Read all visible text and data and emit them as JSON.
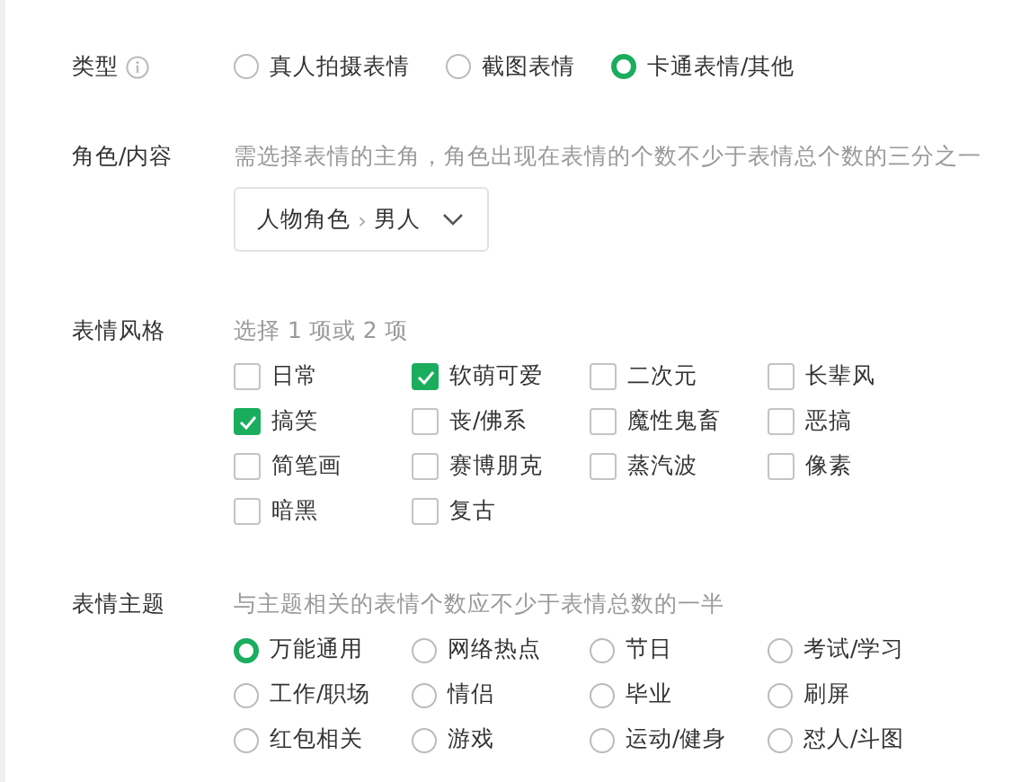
{
  "type_field": {
    "label": "类型",
    "options": [
      {
        "label": "真人拍摄表情",
        "selected": false
      },
      {
        "label": "截图表情",
        "selected": false
      },
      {
        "label": "卡通表情/其他",
        "selected": true
      }
    ]
  },
  "role": {
    "label": "角色/内容",
    "hint": "需选择表情的主角，角色出现在表情的个数不少于表情总个数的三分之一",
    "category": "人物角色",
    "separator": "›",
    "value": "男人"
  },
  "style": {
    "label": "表情风格",
    "hint": "选择 1 项或 2 项",
    "options": [
      {
        "label": "日常",
        "checked": false
      },
      {
        "label": "软萌可爱",
        "checked": true
      },
      {
        "label": "二次元",
        "checked": false
      },
      {
        "label": "长辈风",
        "checked": false
      },
      {
        "label": "搞笑",
        "checked": true
      },
      {
        "label": "丧/佛系",
        "checked": false
      },
      {
        "label": "魔性鬼畜",
        "checked": false
      },
      {
        "label": "恶搞",
        "checked": false
      },
      {
        "label": "简笔画",
        "checked": false
      },
      {
        "label": "赛博朋克",
        "checked": false
      },
      {
        "label": "蒸汽波",
        "checked": false
      },
      {
        "label": "像素",
        "checked": false
      },
      {
        "label": "暗黑",
        "checked": false
      },
      {
        "label": "复古",
        "checked": false
      }
    ]
  },
  "theme": {
    "label": "表情主题",
    "hint": "与主题相关的表情个数应不少于表情总数的一半",
    "options": [
      {
        "label": "万能通用",
        "selected": true
      },
      {
        "label": "网络热点",
        "selected": false
      },
      {
        "label": "节日",
        "selected": false
      },
      {
        "label": "考试/学习",
        "selected": false
      },
      {
        "label": "工作/职场",
        "selected": false
      },
      {
        "label": "情侣",
        "selected": false
      },
      {
        "label": "毕业",
        "selected": false
      },
      {
        "label": "刷屏",
        "selected": false
      },
      {
        "label": "红包相关",
        "selected": false
      },
      {
        "label": "游戏",
        "selected": false
      },
      {
        "label": "运动/健身",
        "selected": false
      },
      {
        "label": "怼人/斗图",
        "selected": false
      }
    ]
  }
}
